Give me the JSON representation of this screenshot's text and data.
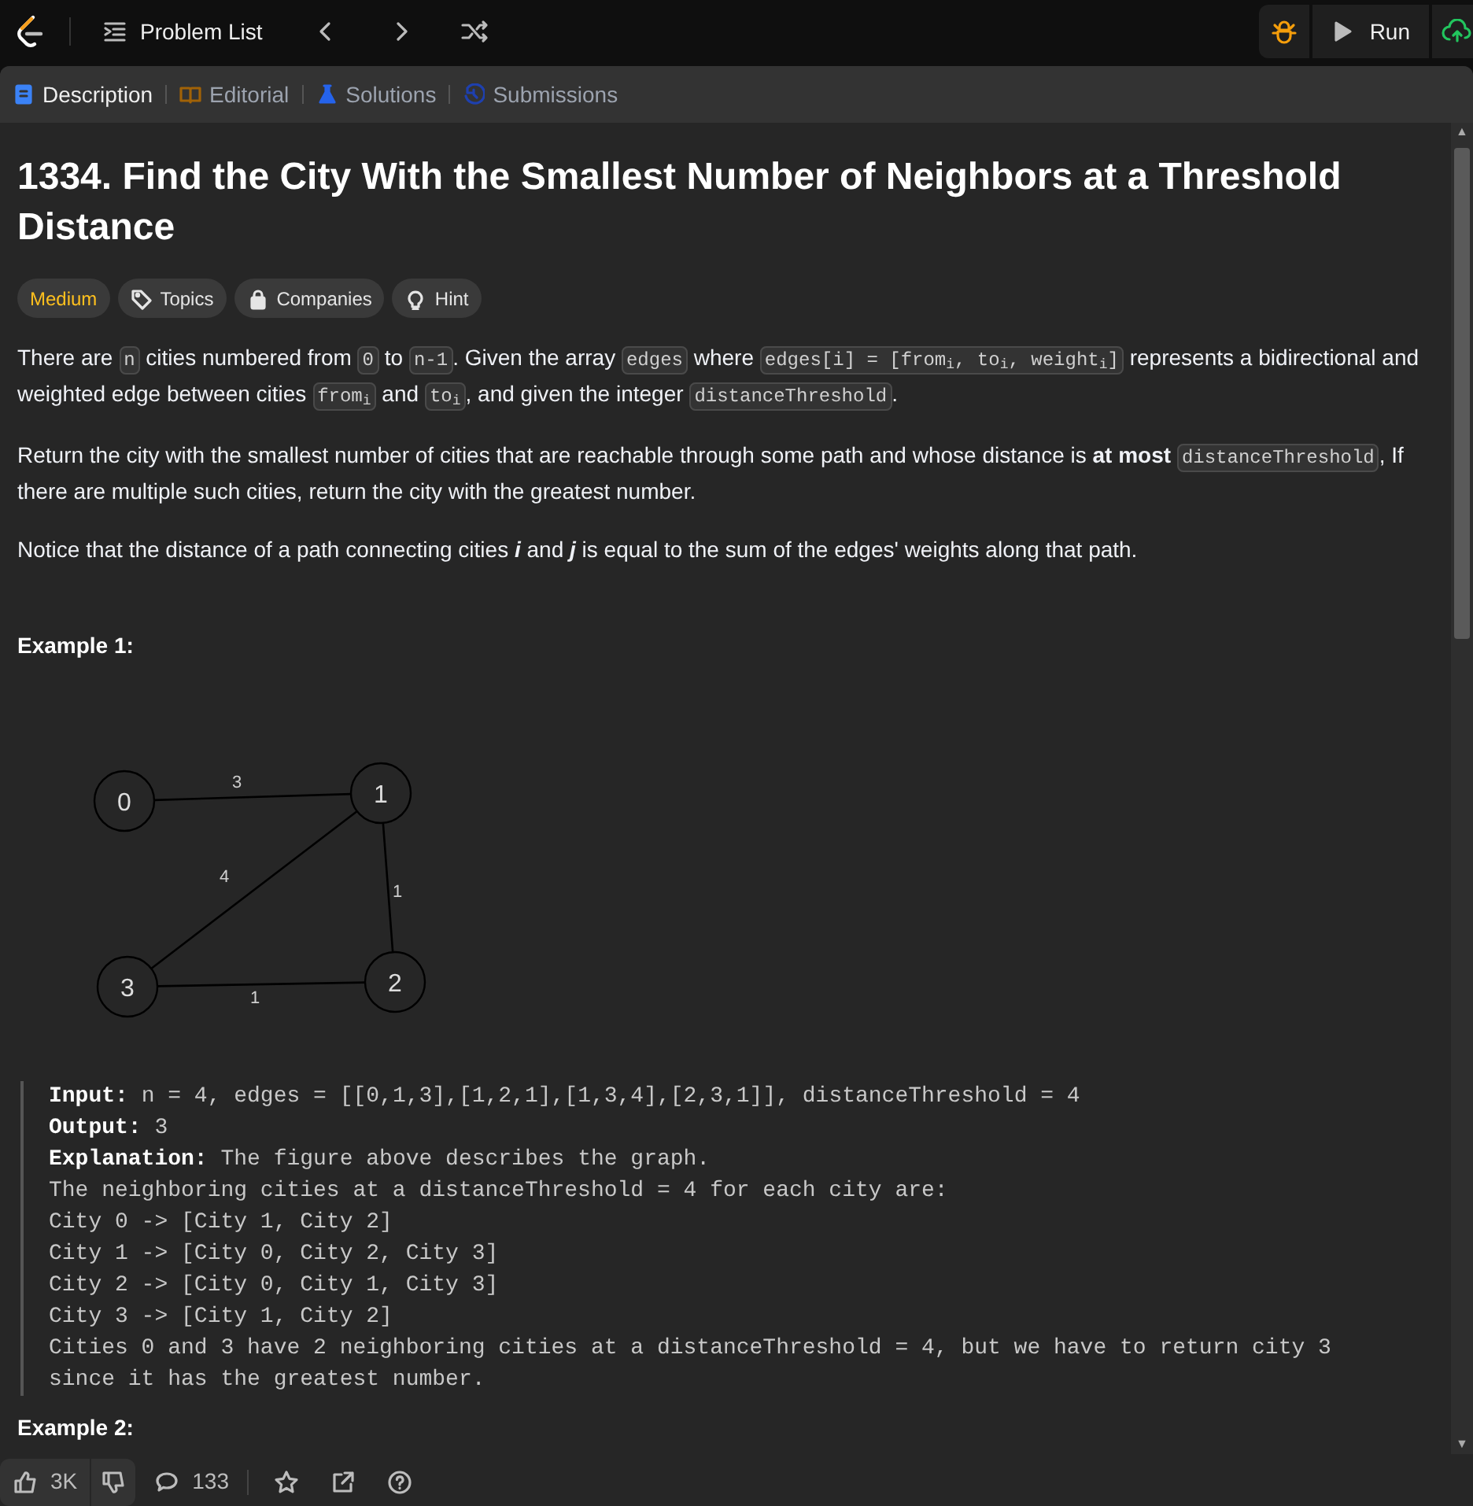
{
  "topbar": {
    "nav_label": "Problem List",
    "run_label": "Run"
  },
  "tabs": [
    {
      "label": "Description",
      "selected": true,
      "color": "#3b82f6"
    },
    {
      "label": "Editorial",
      "selected": false,
      "color": "#a16207"
    },
    {
      "label": "Solutions",
      "selected": false,
      "color": "#2563eb"
    },
    {
      "label": "Submissions",
      "selected": false,
      "color": "#1e40af"
    }
  ],
  "title": "1334. Find the City With the Smallest Number of Neighbors at a Threshold Distance",
  "tags": [
    {
      "label": "Medium",
      "kind": "difficulty"
    },
    {
      "label": "Topics",
      "kind": "topics"
    },
    {
      "label": "Companies",
      "kind": "companies"
    },
    {
      "label": "Hint",
      "kind": "hint"
    }
  ],
  "paragraphs": [
    [
      {
        "kind": "text",
        "text": "There are "
      },
      {
        "kind": "code",
        "text": "n"
      },
      {
        "kind": "text",
        "text": " cities numbered from "
      },
      {
        "kind": "code",
        "text": "0"
      },
      {
        "kind": "text",
        "text": " to "
      },
      {
        "kind": "code",
        "text": "n-1"
      },
      {
        "kind": "text",
        "text": ". Given the array "
      },
      {
        "kind": "code",
        "text": "edges"
      },
      {
        "kind": "text",
        "text": " where "
      },
      {
        "kind": "code",
        "text": "edges[i] = [from$_{i}$, to$_{i}$, weight$_{i}$]"
      },
      {
        "kind": "text",
        "text": " represents a bidirectional and weighted edge between cities "
      },
      {
        "kind": "code",
        "text": "from$_{i}$"
      },
      {
        "kind": "text",
        "text": " and "
      },
      {
        "kind": "code",
        "text": "to$_{i}$"
      },
      {
        "kind": "text",
        "text": ", and given the integer "
      },
      {
        "kind": "code",
        "text": "distanceThreshold"
      },
      {
        "kind": "text",
        "text": "."
      }
    ],
    [
      {
        "kind": "text",
        "text": "Return the city with the smallest number of cities that are reachable through some path and whose distance is "
      },
      {
        "kind": "bold",
        "text": "at most "
      },
      {
        "kind": "code",
        "text": "distanceThreshold"
      },
      {
        "kind": "text",
        "text": ", If there are multiple such cities, return the city with the greatest number."
      }
    ],
    [
      {
        "kind": "text",
        "text": "Notice that the distance of a path connecting cities "
      },
      {
        "kind": "italic",
        "text": "i"
      },
      {
        "kind": "text",
        "text": " and "
      },
      {
        "kind": "italic",
        "text": "j"
      },
      {
        "kind": "text",
        "text": " is equal to the sum of the edges' weights along that path."
      }
    ]
  ],
  "example1": {
    "heading": "Example 1:",
    "graph": {
      "nodes": [
        "0",
        "1",
        "3",
        "2"
      ],
      "edges": [
        {
          "weight": "3"
        },
        {
          "weight": "1"
        },
        {
          "weight": "4"
        },
        {
          "weight": "1"
        }
      ]
    },
    "lines": [
      {
        "label": "Input:",
        "text": "n = 4, edges = [[0,1,3],[1,2,1],[1,3,4],[2,3,1]], distanceThreshold = 4"
      },
      {
        "label": "Output:",
        "text": "3"
      },
      {
        "label": "Explanation:",
        "text": "The figure above describes the graph."
      },
      {
        "text": "The neighboring cities at a distanceThreshold = 4 for each city are:"
      },
      {
        "text": "City 0 -> [City 1, City 2]"
      },
      {
        "text": "City 1 -> [City 0, City 2, City 3]"
      },
      {
        "text": "City 2 -> [City 0, City 1, City 3]"
      },
      {
        "text": "City 3 -> [City 1, City 2]"
      },
      {
        "text": "Cities 0 and 3 have 2 neighboring cities at a distanceThreshold = 4, but we have to return city 3 since it has the greatest number."
      }
    ]
  },
  "example2": {
    "heading": "Example 2:"
  },
  "scrollbar": {
    "up": "▲",
    "down": "▼"
  },
  "footer": {
    "likes": "3K",
    "comments": "133"
  }
}
